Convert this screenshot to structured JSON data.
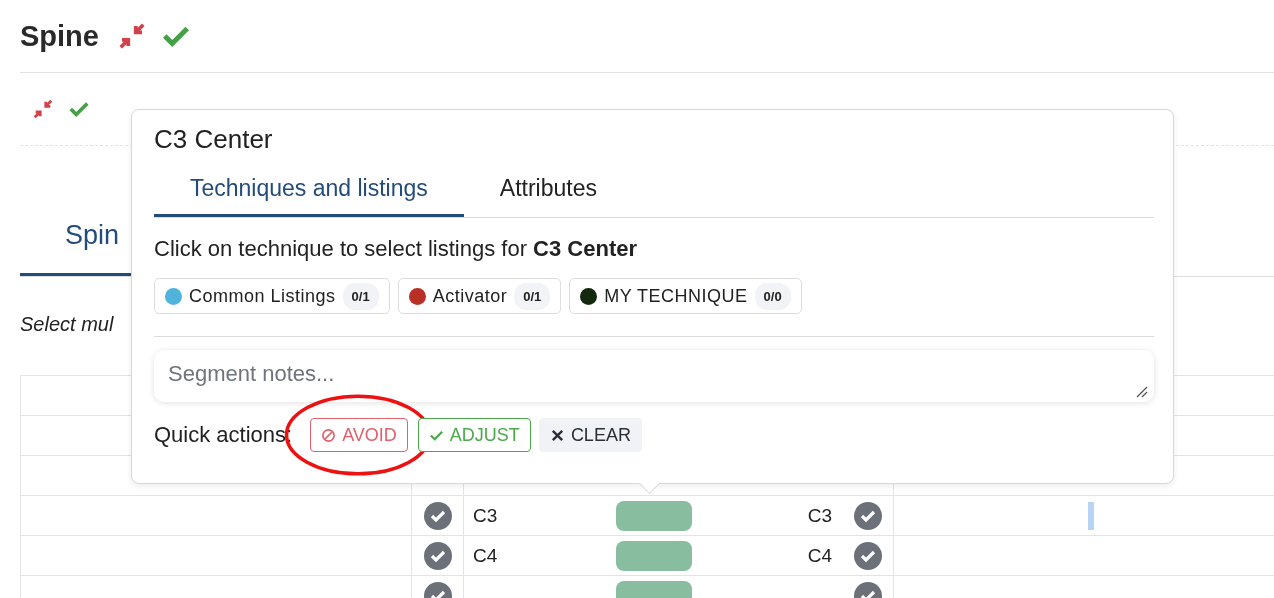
{
  "page": {
    "title": "Spine",
    "tabs": [
      {
        "label": "Spin",
        "selected": true
      }
    ],
    "hint": "Select mul"
  },
  "table": {
    "rows": [
      {
        "left_label": "C3",
        "right_label": "C3",
        "left_checked": true,
        "right_checked": true,
        "marker": true
      },
      {
        "left_label": "C4",
        "right_label": "C4",
        "left_checked": true,
        "right_checked": true,
        "marker": false
      },
      {
        "left_checked": true,
        "right_checked": true,
        "marker": false
      }
    ]
  },
  "popover": {
    "title": "C3 Center",
    "tabs": [
      {
        "label": "Techniques and listings",
        "selected": true
      },
      {
        "label": "Attributes",
        "selected": false
      }
    ],
    "instruction": "Click on technique to select listings for **C3 Center**",
    "techniques": [
      {
        "name": "Common Listings",
        "count": "0/1",
        "color": "#4fb3dc"
      },
      {
        "name": "Activator",
        "count": "0/1",
        "color": "#b83026"
      },
      {
        "name": "MY TECHNIQUE",
        "count": "0/0",
        "color": "#14280f"
      }
    ],
    "notes_placeholder": "Segment notes...",
    "quick_actions_label": "Quick actions:",
    "actions": [
      {
        "kind": "avoid",
        "label": "AVOID",
        "highlighted": true
      },
      {
        "kind": "adjust",
        "label": "ADJUST",
        "highlighted": false
      },
      {
        "kind": "clear",
        "label": "CLEAR",
        "highlighted": false
      }
    ]
  }
}
